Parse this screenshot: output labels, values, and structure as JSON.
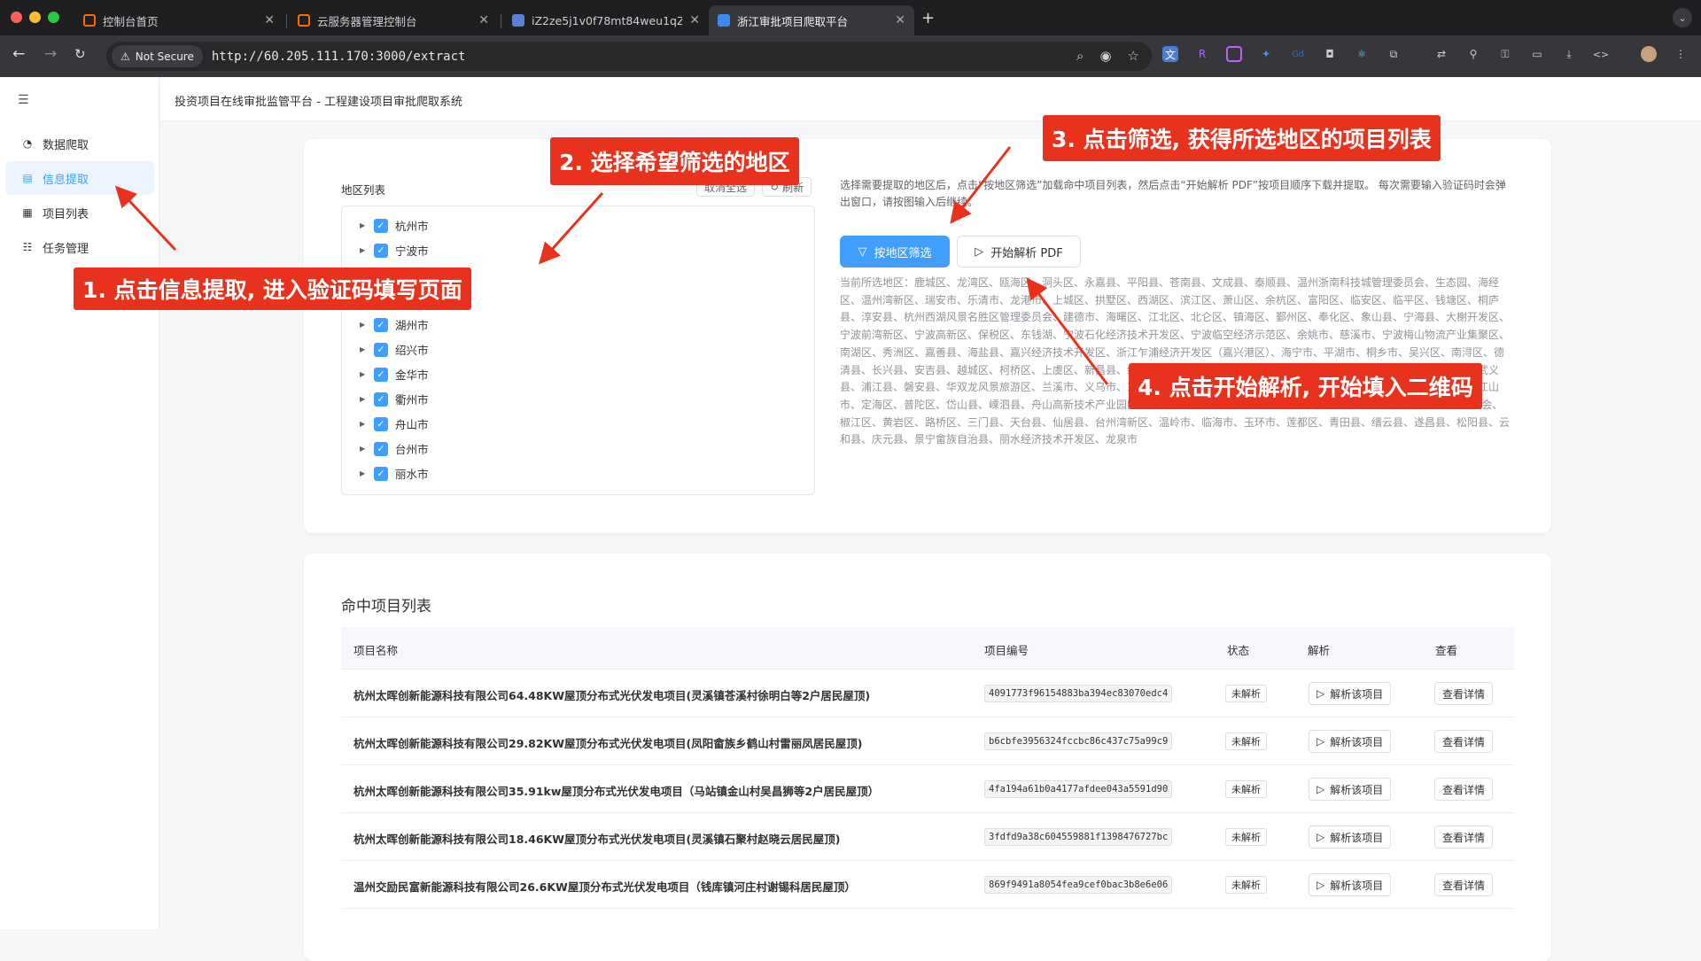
{
  "browser": {
    "tabs": [
      {
        "title": "控制台首页"
      },
      {
        "title": "云服务器管理控制台"
      },
      {
        "title": "iZ2ze5j1v0f78mt84weu1qZ -"
      },
      {
        "title": "浙江审批项目爬取平台"
      }
    ],
    "not_secure": "Not Secure",
    "url": "http://60.205.111.170:3000/extract"
  },
  "sidebar": {
    "items": [
      {
        "label": "数据爬取"
      },
      {
        "label": "信息提取"
      },
      {
        "label": "项目列表"
      },
      {
        "label": "任务管理"
      }
    ]
  },
  "header": {
    "title": "投资项目在线审批监管平台 - 工程建设项目审批爬取系统"
  },
  "region_panel": {
    "title": "地区列表",
    "deselect_label": "取消全选",
    "refresh_label": "刷新",
    "cities": [
      "杭州市",
      "宁波市",
      "湖州市",
      "绍兴市",
      "金华市",
      "衢州市",
      "舟山市",
      "台州市",
      "丽水市"
    ]
  },
  "actions": {
    "description": "选择需要提取的地区后，点击“按地区筛选”加载命中项目列表，然后点击“开始解析 PDF”按项目顺序下载并提取。 每次需要输入验证码时会弹出窗口，请按图输入后继续。",
    "filter_label": "按地区筛选",
    "parse_label": "开始解析 PDF",
    "selected_regions": "当前所选地区：鹿城区、龙湾区、瓯海区、洞头区、永嘉县、平阳县、苍南县、文成县、泰顺县、温州浙南科技城管理委员会、生态园、海经区、温州湾新区、瑞安市、乐清市、龙港市、上城区、拱墅区、西湖区、滨江区、萧山区、余杭区、富阳区、临安区、临平区、钱塘区、桐庐县、淳安县、杭州西湖风景名胜区管理委员会、建德市、海曙区、江北区、北仑区、镇海区、鄞州区、奉化区、象山县、宁海县、大榭开发区、宁波前湾新区、宁波高新区、保税区、东钱湖、宁波石化经济技术开发区、宁波临空经济示范区、余姚市、慈溪市、宁波梅山物流产业集聚区、南湖区、秀洲区、嘉善县、海盐县、嘉兴经济技术开发区、浙江乍浦经济开发区（嘉兴港区）、海宁市、平湖市、桐乡市、吴兴区、南浔区、德清县、长兴县、安吉县、越城区、柯桥区、上虞区、新昌县、绍兴滨海新区管理委员会、镜湖新区、诸暨市、嵊州市、婺城区、金东区、武义县、浦江县、磐安县、华双龙风景旅游区、兰溪市、义乌市、东阳市、永康市、柯城区、衢江区、常山县、开化县、龙游县、智造新城、江山市、定海区、普陀区、岱山县、嵊泗县、舟山高新技术产业园区管理委员会、新城管委会、普陀山-朱家尖管委会、金塘管委会、六横管委会、椒江区、黄岩区、路桥区、三门县、天台县、仙居县、台州湾新区、温岭市、临海市、玉环市、莲都区、青田县、缙云县、遂昌县、松阳县、云和县、庆元县、景宁畲族自治县、丽水经济技术开发区、龙泉市"
  },
  "project_list": {
    "title": "命中项目列表",
    "columns": [
      "项目名称",
      "项目编号",
      "状态",
      "解析",
      "查看"
    ],
    "parse_label": "解析该项目",
    "detail_label": "查看详情",
    "rows": [
      {
        "name": "杭州太晖创新能源科技有限公司64.48KW屋顶分布式光伏发电项目(灵溪镇苍溪村徐明白等2户居民屋顶)",
        "code": "4091773f96154883ba394ec83070edc4",
        "status": "未解析"
      },
      {
        "name": "杭州太晖创新能源科技有限公司29.82KW屋顶分布式光伏发电项目(凤阳畲族乡鹤山村雷丽凤居民屋顶)",
        "code": "b6cbfe3956324fccbc86c437c75a99c9",
        "status": "未解析"
      },
      {
        "name": "杭州太晖创新能源科技有限公司35.91kw屋顶分布式光伏发电项目（马站镇金山村吴昌狮等2户居民屋顶）",
        "code": "4fa194a61b0a4177afdee043a5591d90",
        "status": "未解析"
      },
      {
        "name": "杭州太晖创新能源科技有限公司18.46KW屋顶分布式光伏发电项目(灵溪镇石聚村赵晓云居民屋顶)",
        "code": "3fdfd9a38c604559881f1398476727bc",
        "status": "未解析"
      },
      {
        "name": "温州交励民富新能源科技有限公司26.6KW屋顶分布式光伏发电项目（钱库镇河庄村谢锡科居民屋顶）",
        "code": "869f9491a8054fea9cef0bac3b8e6e06",
        "status": "未解析"
      }
    ]
  },
  "callouts": [
    {
      "text": "1. 点击信息提取, 进入验证码填写页面"
    },
    {
      "text": "2. 选择希望筛选的地区"
    },
    {
      "text": "3. 点击筛选, 获得所选地区的项目列表"
    },
    {
      "text": "4. 点击开始解析, 开始填入二维码"
    }
  ],
  "colors": {
    "primary": "#409eff",
    "callout": "#e8321d"
  }
}
